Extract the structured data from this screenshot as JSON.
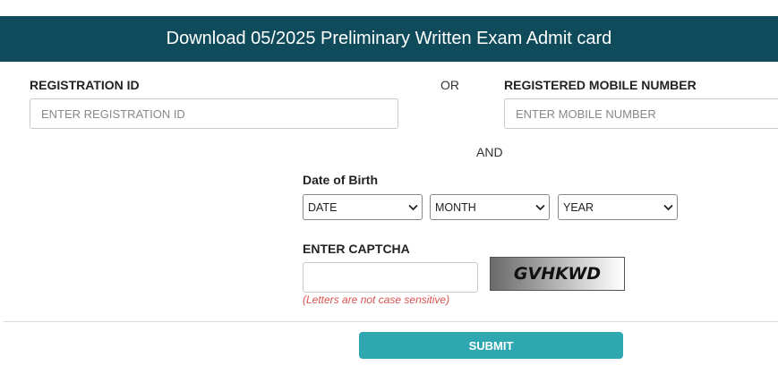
{
  "header": {
    "title": "Download 05/2025 Preliminary Written Exam Admit card"
  },
  "registration": {
    "label": "REGISTRATION ID",
    "placeholder": "ENTER REGISTRATION ID",
    "value": ""
  },
  "or_text": "OR",
  "mobile": {
    "label": "REGISTERED MOBILE NUMBER",
    "placeholder": "ENTER MOBILE NUMBER",
    "value": ""
  },
  "and_text": "AND",
  "dob": {
    "label": "Date of Birth",
    "day_selected": "DATE",
    "month_selected": "MONTH",
    "year_selected": "YEAR"
  },
  "captcha": {
    "label": "ENTER CAPTCHA",
    "value": "",
    "image_text": "GVHKWD",
    "hint": "(Letters are not case sensitive)"
  },
  "submit_label": "SUBMIT",
  "colors": {
    "header_bg": "#0f4b5a",
    "submit_bg": "#2ea7b0",
    "hint_text": "#d9534f"
  },
  "icons": {
    "select_arrow": "chevron-down-icon"
  }
}
